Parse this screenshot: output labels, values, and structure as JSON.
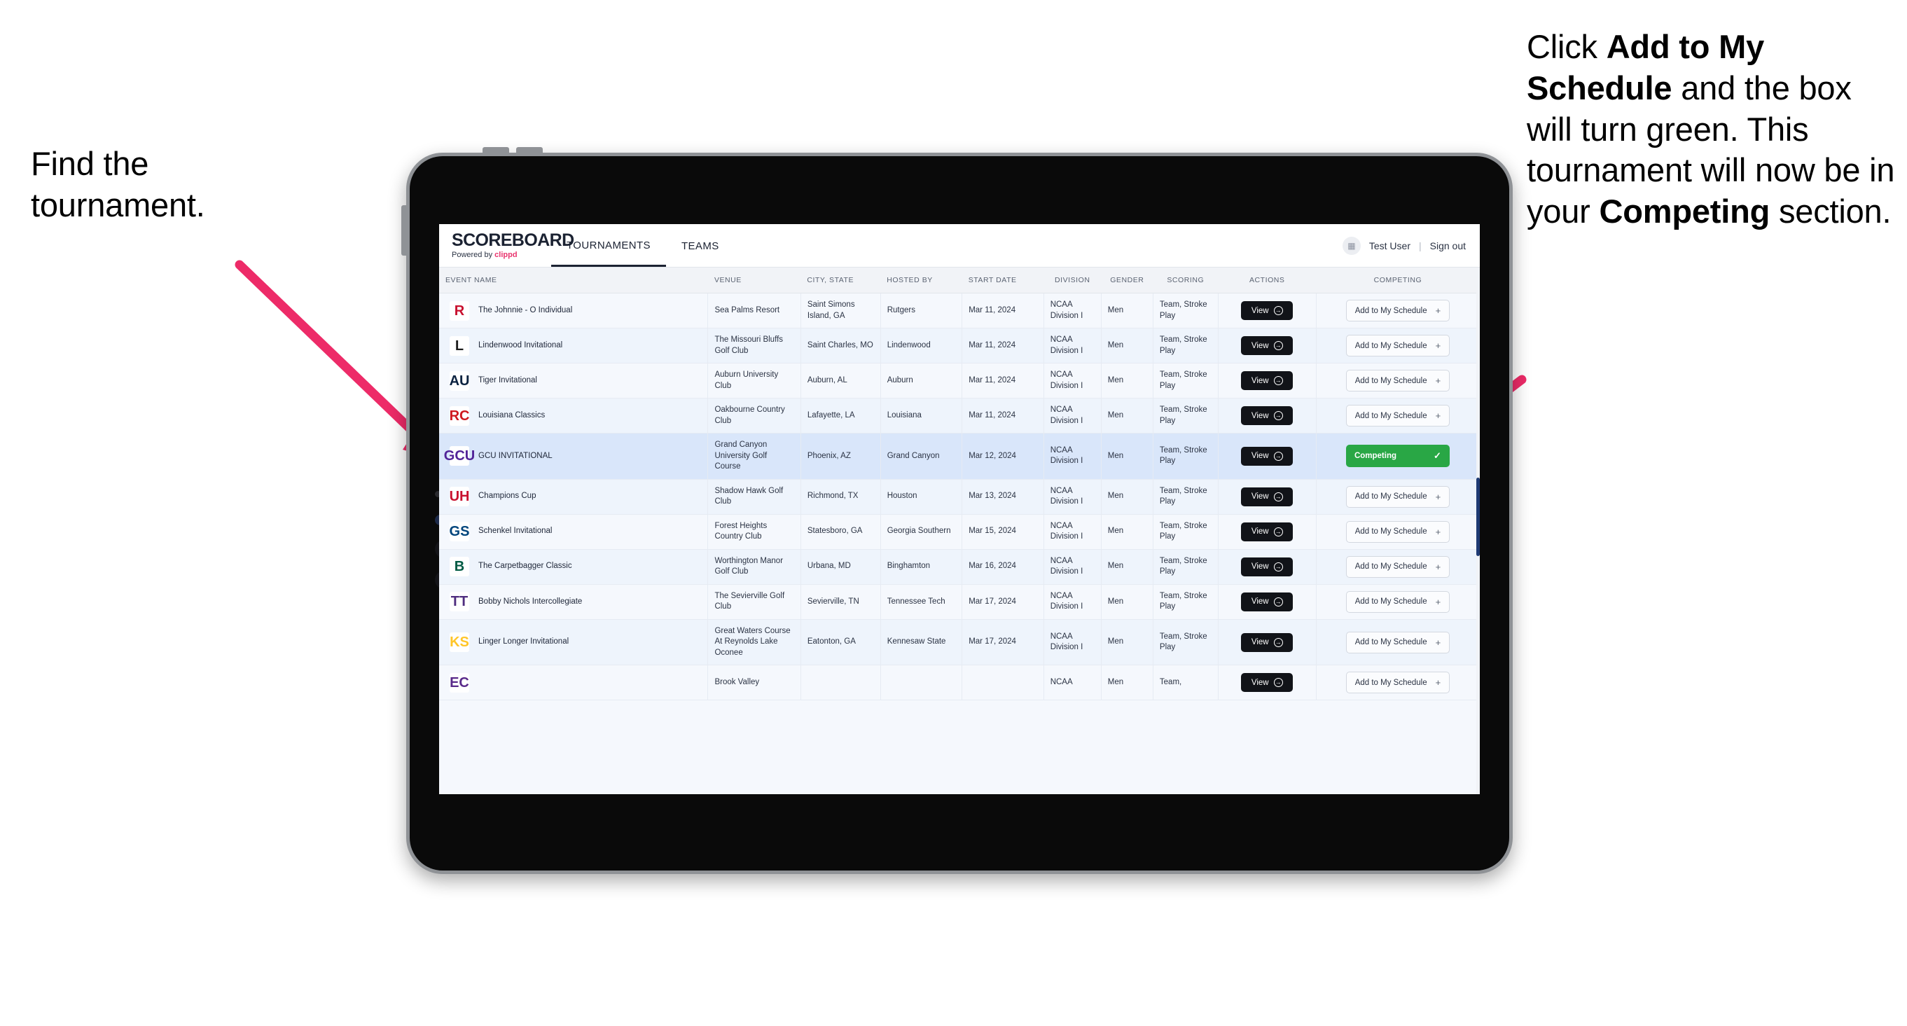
{
  "annotations": {
    "left": {
      "line1": "Find the",
      "line2": "tournament."
    },
    "right": {
      "p1_pre": "Click ",
      "p1_bold": "Add to My Schedule",
      "p1_post": " and the box will turn green. This tournament will now be in your ",
      "p2_bold": "Competing",
      "p2_post": " section."
    },
    "arrow_color": "#ED2B68"
  },
  "app": {
    "brand": {
      "title": "SCOREBOARD",
      "sub_pre": "Powered by ",
      "sub_brand": "clippd"
    },
    "nav": [
      {
        "label": "TOURNAMENTS",
        "active": true
      },
      {
        "label": "TEAMS",
        "active": false
      }
    ],
    "header_right": {
      "avatar_icon": "user-badge-icon",
      "user": "Test User",
      "separator": "|",
      "signout": "Sign out"
    },
    "columns": [
      "EVENT NAME",
      "VENUE",
      "CITY, STATE",
      "HOSTED BY",
      "START DATE",
      "DIVISION",
      "GENDER",
      "SCORING",
      "ACTIONS",
      "COMPETING"
    ],
    "buttons": {
      "view": "View",
      "view_icon": "arrow-right-circle-icon",
      "add": "Add to My Schedule",
      "add_icon": "plus-icon",
      "competing": "Competing",
      "competing_icon": "check-icon"
    },
    "rows": [
      {
        "logo_text": "R",
        "logo_bg": "#ffffff",
        "logo_color": "#c8102e",
        "name": "The Johnnie - O Individual",
        "venue": "Sea Palms Resort",
        "city": "Saint Simons Island, GA",
        "host": "Rutgers",
        "date": "Mar 11, 2024",
        "division": "NCAA Division I",
        "gender": "Men",
        "scoring": "Team, Stroke Play",
        "competing": false
      },
      {
        "logo_text": "L",
        "logo_bg": "#ffffff",
        "logo_color": "#1d1d1d",
        "name": "Lindenwood Invitational",
        "venue": "The Missouri Bluffs Golf Club",
        "city": "Saint Charles, MO",
        "host": "Lindenwood",
        "date": "Mar 11, 2024",
        "division": "NCAA Division I",
        "gender": "Men",
        "scoring": "Team, Stroke Play",
        "competing": false
      },
      {
        "logo_text": "AU",
        "logo_bg": "#ffffff",
        "logo_color": "#0c2340",
        "name": "Tiger Invitational",
        "venue": "Auburn University Club",
        "city": "Auburn, AL",
        "host": "Auburn",
        "date": "Mar 11, 2024",
        "division": "NCAA Division I",
        "gender": "Men",
        "scoring": "Team, Stroke Play",
        "competing": false
      },
      {
        "logo_text": "RC",
        "logo_bg": "#ffffff",
        "logo_color": "#ce181e",
        "name": "Louisiana Classics",
        "venue": "Oakbourne Country Club",
        "city": "Lafayette, LA",
        "host": "Louisiana",
        "date": "Mar 11, 2024",
        "division": "NCAA Division I",
        "gender": "Men",
        "scoring": "Team, Stroke Play",
        "competing": false
      },
      {
        "logo_text": "GCU",
        "logo_bg": "#ffffff",
        "logo_color": "#522398",
        "name": "GCU INVITATIONAL",
        "venue": "Grand Canyon University Golf Course",
        "city": "Phoenix, AZ",
        "host": "Grand Canyon",
        "date": "Mar 12, 2024",
        "division": "NCAA Division I",
        "gender": "Men",
        "scoring": "Team, Stroke Play",
        "competing": true
      },
      {
        "logo_text": "UH",
        "logo_bg": "#ffffff",
        "logo_color": "#c8102e",
        "name": "Champions Cup",
        "venue": "Shadow Hawk Golf Club",
        "city": "Richmond, TX",
        "host": "Houston",
        "date": "Mar 13, 2024",
        "division": "NCAA Division I",
        "gender": "Men",
        "scoring": "Team, Stroke Play",
        "competing": false
      },
      {
        "logo_text": "GS",
        "logo_bg": "#ffffff",
        "logo_color": "#00457c",
        "name": "Schenkel Invitational",
        "venue": "Forest Heights Country Club",
        "city": "Statesboro, GA",
        "host": "Georgia Southern",
        "date": "Mar 15, 2024",
        "division": "NCAA Division I",
        "gender": "Men",
        "scoring": "Team, Stroke Play",
        "competing": false
      },
      {
        "logo_text": "B",
        "logo_bg": "#ffffff",
        "logo_color": "#005a43",
        "name": "The Carpetbagger Classic",
        "venue": "Worthington Manor Golf Club",
        "city": "Urbana, MD",
        "host": "Binghamton",
        "date": "Mar 16, 2024",
        "division": "NCAA Division I",
        "gender": "Men",
        "scoring": "Team, Stroke Play",
        "competing": false
      },
      {
        "logo_text": "TT",
        "logo_bg": "#ffffff",
        "logo_color": "#4f2d7f",
        "name": "Bobby Nichols Intercollegiate",
        "venue": "The Sevierville Golf Club",
        "city": "Sevierville, TN",
        "host": "Tennessee Tech",
        "date": "Mar 17, 2024",
        "division": "NCAA Division I",
        "gender": "Men",
        "scoring": "Team, Stroke Play",
        "competing": false
      },
      {
        "logo_text": "KS",
        "logo_bg": "#ffffff",
        "logo_color": "#ffc629",
        "name": "Linger Longer Invitational",
        "venue": "Great Waters Course At Reynolds Lake Oconee",
        "city": "Eatonton, GA",
        "host": "Kennesaw State",
        "date": "Mar 17, 2024",
        "division": "NCAA Division I",
        "gender": "Men",
        "scoring": "Team, Stroke Play",
        "competing": false
      },
      {
        "logo_text": "EC",
        "logo_bg": "#ffffff",
        "logo_color": "#592a8a",
        "name": "",
        "venue": "Brook Valley",
        "city": "",
        "host": "",
        "date": "",
        "division": "NCAA",
        "gender": "Men",
        "scoring": "Team,",
        "competing": false
      }
    ]
  }
}
